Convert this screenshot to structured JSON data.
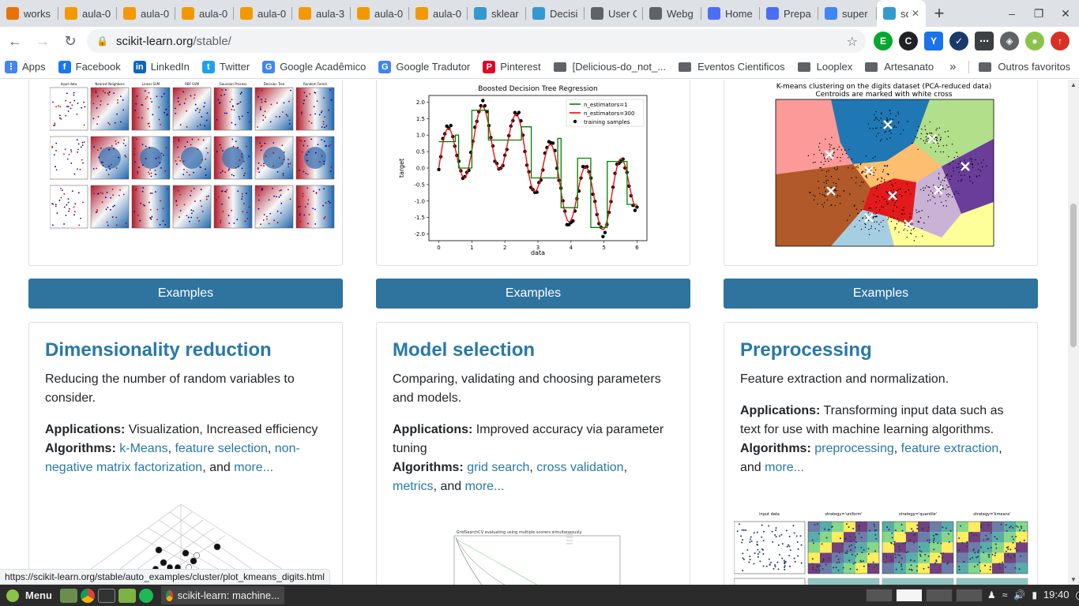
{
  "browser": {
    "tabs": [
      {
        "title": "works",
        "color": "#e8710a"
      },
      {
        "title": "aula-0",
        "color": "#f29900"
      },
      {
        "title": "aula-0",
        "color": "#f29900"
      },
      {
        "title": "aula-0",
        "color": "#f29900"
      },
      {
        "title": "aula-0",
        "color": "#f29900"
      },
      {
        "title": "aula-3",
        "color": "#f29900"
      },
      {
        "title": "aula-0",
        "color": "#f29900"
      },
      {
        "title": "aula-0",
        "color": "#f29900"
      },
      {
        "title": "sklear",
        "color": "#3499cd"
      },
      {
        "title": "Decisi",
        "color": "#3499cd"
      },
      {
        "title": "User G",
        "color": "#5f6368"
      },
      {
        "title": "Webg",
        "color": "#5f6368"
      },
      {
        "title": "Home",
        "color": "#4c6ef5"
      },
      {
        "title": "Prepa",
        "color": "#4c6ef5"
      },
      {
        "title": "super",
        "color": "#4285f4"
      }
    ],
    "active_tab": {
      "title": "sc",
      "color": "#3499cd"
    },
    "url_host": "scikit-learn.org",
    "url_path": "/stable/",
    "bookmarks": [
      {
        "label": "Apps",
        "icon": "apps-icon"
      },
      {
        "label": "Facebook",
        "icon": "facebook-icon"
      },
      {
        "label": "LinkedIn",
        "icon": "linkedin-icon"
      },
      {
        "label": "Twitter",
        "icon": "twitter-icon"
      },
      {
        "label": "Google Acadêmico",
        "icon": "scholar-icon"
      },
      {
        "label": "Google Tradutor",
        "icon": "translate-icon"
      },
      {
        "label": "Pinterest",
        "icon": "pinterest-icon"
      },
      {
        "label": "[Delicious-do_not_...",
        "icon": "folder-icon"
      },
      {
        "label": "Eventos Cientificos",
        "icon": "folder-icon"
      },
      {
        "label": "Looplex",
        "icon": "folder-icon"
      },
      {
        "label": "Artesanato",
        "icon": "folder-icon"
      }
    ],
    "other_bookmarks": "Outros favoritos",
    "status_url": "https://scikit-learn.org/stable/auto_examples/cluster/plot_kmeans_digits.html"
  },
  "top_cards": [
    {
      "button": "Examples"
    },
    {
      "button": "Examples"
    },
    {
      "button": "Examples"
    }
  ],
  "thumbnails": {
    "classifiers": {
      "column_titles": [
        "Input data",
        "Nearest Neighbors",
        "Linear SVM",
        "RBF SVM",
        "Gaussian Process",
        "Decision Tree",
        "Random Forest"
      ]
    },
    "regression": {
      "title": "Boosted Decision Tree Regression",
      "xlabel": "data",
      "ylabel": "target",
      "legend": [
        "n_estimators=1",
        "n_estimators=300",
        "training samples"
      ],
      "yticks": [
        "2.0",
        "1.5",
        "1.0",
        "0.5",
        "0.0",
        "-0.5",
        "-1.0",
        "-1.5",
        "-2.0"
      ],
      "xticks": [
        "0",
        "1",
        "2",
        "3",
        "4",
        "5",
        "6"
      ]
    },
    "kmeans": {
      "title_line1": "K-means clustering on the digits dataset (PCA-reduced data)",
      "title_line2": "Centroids are marked with white cross"
    },
    "gridsearch": {
      "title": "GridSearchCV evaluating using multiple scorers simultaneously"
    },
    "discretize": {
      "titles": [
        "input data",
        "strategy='uniform'",
        "strategy='quantile'",
        "strategy='kmeans'"
      ]
    }
  },
  "bottom_cards": [
    {
      "title": "Dimensionality reduction",
      "desc": "Reducing the number of random variables to consider.",
      "app_label": "Applications:",
      "app_text": "Visualization, Increased efficiency",
      "alg_label": "Algorithms:",
      "links": [
        "k-Means",
        "feature selection",
        "non-negative matrix factorization"
      ],
      "and": ", and ",
      "more": "more..."
    },
    {
      "title": "Model selection",
      "desc": "Comparing, validating and choosing parameters and models.",
      "app_label": "Applications:",
      "app_text": "Improved accuracy via parameter tuning",
      "alg_label": "Algorithms:",
      "links": [
        "grid search",
        "cross validation",
        "metrics"
      ],
      "and": ", and ",
      "more": "more..."
    },
    {
      "title": "Preprocessing",
      "desc": "Feature extraction and normalization.",
      "app_label": "Applications:",
      "app_text": "Transforming input data such as text for use with machine learning algorithms.",
      "alg_label": "Algorithms:",
      "links": [
        "preprocessing",
        "feature extraction"
      ],
      "and": ", and ",
      "more": "more..."
    }
  ],
  "taskbar": {
    "menu": "Menu",
    "window_title": "scikit-learn: machine...",
    "clock": "19:40"
  }
}
